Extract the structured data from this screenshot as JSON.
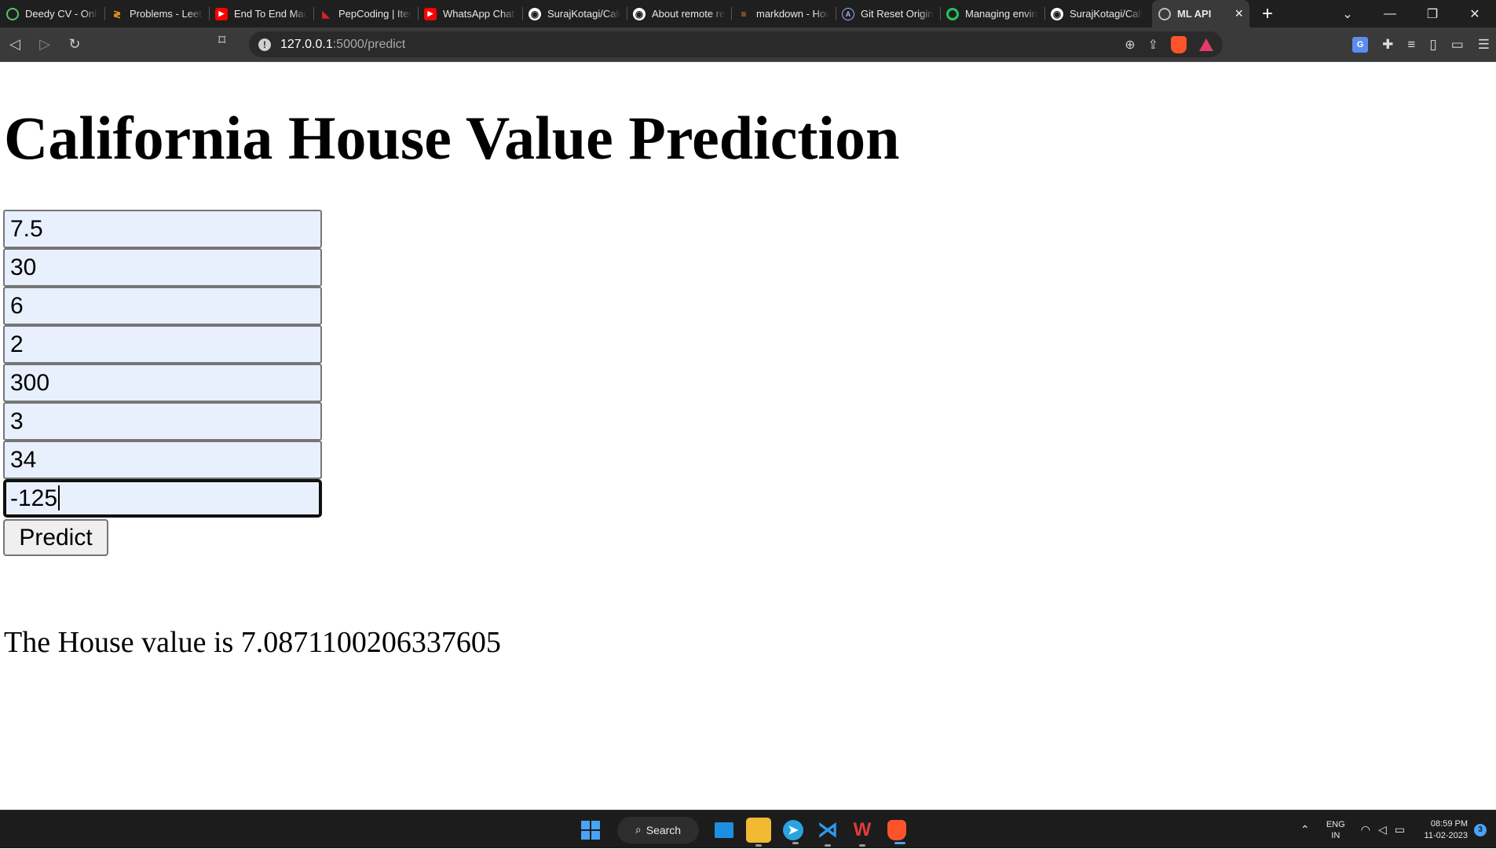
{
  "browser": {
    "tabs": [
      {
        "label": "Deedy CV - Onlin",
        "icon": "deedy-icon"
      },
      {
        "label": "Problems - LeetC",
        "icon": "leetcode-icon"
      },
      {
        "label": "End To End Mach",
        "icon": "youtube-icon"
      },
      {
        "label": "PepCoding | Itera",
        "icon": "pepcoding-icon"
      },
      {
        "label": "WhatsApp Chat A",
        "icon": "youtube-icon"
      },
      {
        "label": "SurajKotagi/Calif",
        "icon": "github-icon"
      },
      {
        "label": "About remote re",
        "icon": "github-icon"
      },
      {
        "label": "markdown - How",
        "icon": "stackoverflow-icon"
      },
      {
        "label": "Git Reset Origin -",
        "icon": "a-icon"
      },
      {
        "label": "Managing enviro",
        "icon": "circle-icon"
      },
      {
        "label": "SurajKotagi/Calif",
        "icon": "github-icon"
      },
      {
        "label": "ML API",
        "icon": "globe-icon",
        "active": true
      }
    ],
    "url_host": "127.0.0.1",
    "url_path": ":5000/predict"
  },
  "page": {
    "title": "California House Value Prediction",
    "fields": [
      "7.5",
      "30",
      "6",
      "2",
      "300",
      "3",
      "34",
      "-125"
    ],
    "predict_label": "Predict",
    "result": "The House value is 7.0871100206337605"
  },
  "taskbar": {
    "search_label": "Search",
    "lang_line1": "ENG",
    "lang_line2": "IN",
    "time": "08:59 PM",
    "date": "11-02-2023",
    "notification_count": "3"
  }
}
